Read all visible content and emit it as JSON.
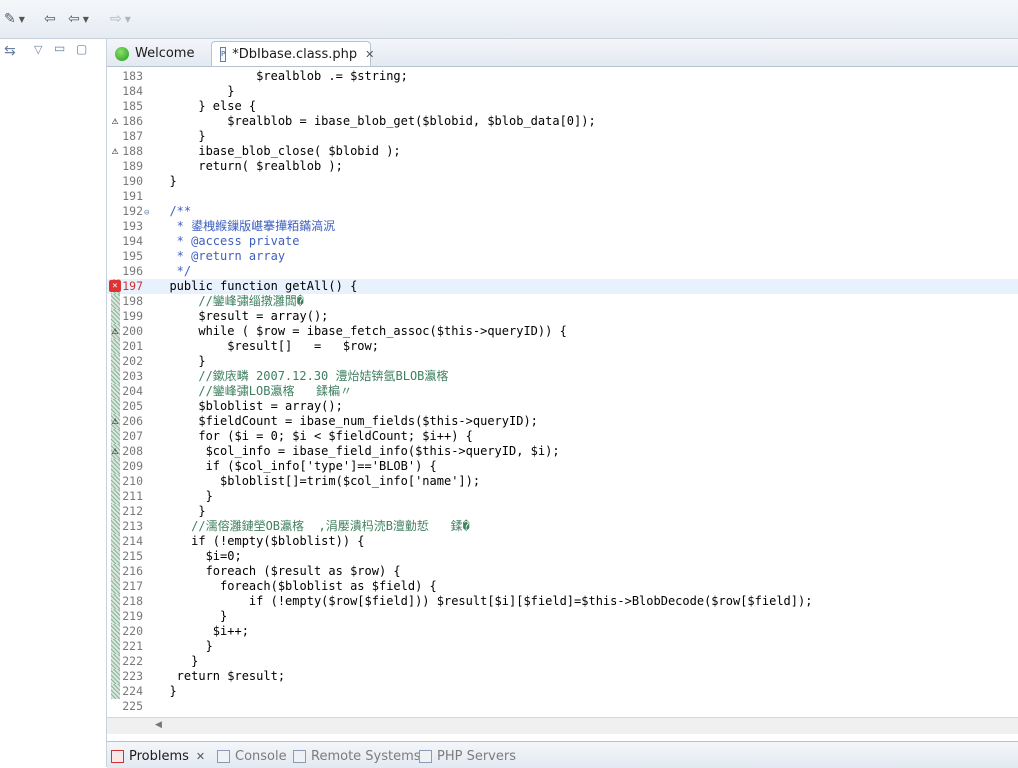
{
  "toolbar": {
    "items": [
      "wand-icon",
      "back-icon",
      "nav-back-icon",
      "nav-forward-icon"
    ]
  },
  "tabs": [
    {
      "label": "Welcome"
    },
    {
      "label": "*DbIbase.class.php"
    }
  ],
  "editor": {
    "lines": [
      {
        "n": "183",
        "text": "              $realblob .= $string;"
      },
      {
        "n": "184",
        "text": "          }"
      },
      {
        "n": "185",
        "text": "      } else {"
      },
      {
        "n": "186",
        "text": "          $realblob = ibase_blob_get($blobid, $blob_data[0]);",
        "marker": "warn"
      },
      {
        "n": "187",
        "text": "      }"
      },
      {
        "n": "188",
        "text": "      ibase_blob_close( $blobid );",
        "marker": "warn"
      },
      {
        "n": "189",
        "text": "      return( $realblob );"
      },
      {
        "n": "190",
        "text": "  }"
      },
      {
        "n": "191",
        "text": ""
      },
      {
        "n": "192",
        "text": "  /**",
        "fold": true
      },
      {
        "n": "193",
        "text": "   * 鍙栧緱鏁版嵁搴撶粨鏋滈泦"
      },
      {
        "n": "194",
        "text": "   * @access private"
      },
      {
        "n": "195",
        "text": "   * @return array"
      },
      {
        "n": "196",
        "text": "   */"
      },
      {
        "n": "197",
        "text": "  public function getAll() {",
        "marker": "err",
        "current": true
      },
      {
        "n": "198",
        "text": "      //鑾峰彇缁撴灉闆�"
      },
      {
        "n": "199",
        "text": "      $result = array();"
      },
      {
        "n": "200",
        "text": "      while ( $row = ibase_fetch_assoc($this->queryID)) {",
        "marker": "warn"
      },
      {
        "n": "201",
        "text": "          $result[]   =   $row;"
      },
      {
        "n": "202",
        "text": "      }"
      },
      {
        "n": "203",
        "text": "      //鏉庡疄 2007.12.30 澧炲姞锛氬BLOB瀛楁"
      },
      {
        "n": "204",
        "text": "      //鑾峰彇LOB瀛楁   鍒楄〃"
      },
      {
        "n": "205",
        "text": "      $bloblist = array();"
      },
      {
        "n": "206",
        "text": "      $fieldCount = ibase_num_fields($this->queryID);",
        "marker": "warn"
      },
      {
        "n": "207",
        "text": "      for ($i = 0; $i < $fieldCount; $i++) {"
      },
      {
        "n": "208",
        "text": "       $col_info = ibase_field_info($this->queryID, $i);",
        "marker": "warn"
      },
      {
        "n": "209",
        "text": "       if ($col_info['type']=='BLOB') {"
      },
      {
        "n": "210",
        "text": "         $bloblist[]=trim($col_info['name']);"
      },
      {
        "n": "211",
        "text": "       }"
      },
      {
        "n": "212",
        "text": "      }"
      },
      {
        "n": "213",
        "text": "     //濡傛灉鏈塋OB瀛楁  ,涓嬮潰杩涜B澶勭悊   鍒�"
      },
      {
        "n": "214",
        "text": "     if (!empty($bloblist)) {"
      },
      {
        "n": "215",
        "text": "       $i=0;"
      },
      {
        "n": "216",
        "text": "       foreach ($result as $row) {"
      },
      {
        "n": "217",
        "text": "         foreach($bloblist as $field) {"
      },
      {
        "n": "218",
        "text": "             if (!empty($row[$field])) $result[$i][$field]=$this->BlobDecode($row[$field]);"
      },
      {
        "n": "219",
        "text": "         }"
      },
      {
        "n": "220",
        "text": "        $i++;"
      },
      {
        "n": "221",
        "text": "       }"
      },
      {
        "n": "222",
        "text": "     }"
      },
      {
        "n": "223",
        "text": "   return $result;"
      },
      {
        "n": "224",
        "text": "  }"
      },
      {
        "n": "225",
        "text": ""
      }
    ]
  },
  "bottom_tabs": [
    {
      "label": "Problems",
      "active": true
    },
    {
      "label": "Console"
    },
    {
      "label": "Remote Systems"
    },
    {
      "label": "PHP Servers"
    }
  ],
  "colors": {
    "keyword": "#7f0055",
    "comment": "#3f5fbf",
    "string": "#2a00ff",
    "current_line": "#e8f2fe"
  }
}
